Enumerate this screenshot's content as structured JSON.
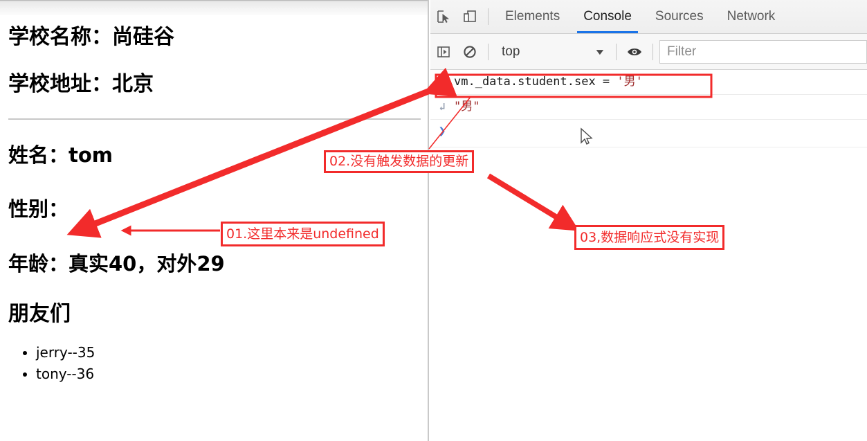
{
  "page": {
    "school_name_label": "学校名称：",
    "school_name_value": "尚硅谷",
    "school_address_label": "学校地址：",
    "school_address_value": "北京",
    "name_line": "姓名：tom",
    "sex_line": "性别：",
    "age_line": "年龄：真实40，对外29",
    "friends_heading": "朋友们",
    "friends": [
      "jerry--35",
      "tony--36"
    ]
  },
  "devtools": {
    "toolbar_icons": [
      {
        "name": "inspect-element-icon",
        "title": "Inspect"
      },
      {
        "name": "device-toolbar-icon",
        "title": "Toggle device toolbar"
      }
    ],
    "tabs": [
      {
        "label": "Elements",
        "active": false
      },
      {
        "label": "Console",
        "active": true
      },
      {
        "label": "Sources",
        "active": false
      },
      {
        "label": "Network",
        "active": false
      }
    ],
    "filterbar": {
      "sidebar_toggle_icon": "console-sidebar-icon",
      "clear_icon": "clear-console-icon",
      "context_value": "top",
      "caret": "▼",
      "eye_icon": "live-expression-eye-icon",
      "filter_placeholder": "Filter",
      "filter_value": ""
    },
    "console_rows": [
      {
        "type": "input",
        "gutter": "❯",
        "expr_before": "vm._data.student.sex = ",
        "expr_string": "'男'"
      },
      {
        "type": "output",
        "gutter": "↲",
        "value": "\"男\""
      },
      {
        "type": "prompt",
        "gutter": "❯",
        "value": ""
      }
    ]
  },
  "annotations": [
    {
      "id": "a01",
      "text": "01.这里本来是undefined"
    },
    {
      "id": "a02",
      "text": "02.没有触发数据的更新"
    },
    {
      "id": "a03",
      "text": "03,数据响应式没有实现"
    }
  ],
  "colors": {
    "annotation_red": "#f22b2b",
    "tab_active_underline": "#1a73e8",
    "console_string": "#a03030"
  }
}
